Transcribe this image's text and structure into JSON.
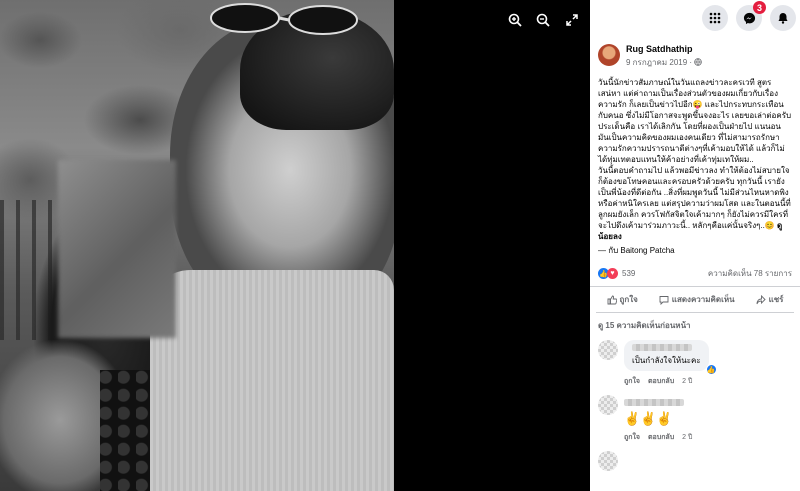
{
  "viewer": {
    "zoom_in_icon": "zoom-in-icon",
    "zoom_out_icon": "zoom-out-icon",
    "fullscreen_icon": "fullscreen-icon"
  },
  "topbar": {
    "menu_icon": "grid-menu-icon",
    "messenger_icon": "messenger-icon",
    "messenger_badge": "3",
    "notification_icon": "bell-icon"
  },
  "post": {
    "author": "Rug Satdhathip",
    "date": "9 กรกฎาคม 2019 · ",
    "globe_icon": "globe-icon",
    "text": "วันนี้นักข่าวสัมภาษณ์ในวันแถลงข่าวละครเวที สูตรเสน่หา แต่ค่าถามเป็นเรื่องส่วนตัวของผมเกี่ยวกับเรื่องความรัก ก็เลยเป็นข่าวไปอีก😜 และไปกระทบกระเทือนกับคนอ ซึ่งไม่มีโอกาสจะพูดขึ้นจงอะไร เลยขอเล่าต่อครับประเด็นคือ เราได้เลิกกัน โดยที่ผองเป็นฝ่ายไป แนนอน มันเป็นความคิดของผมเองคนเดียว ที่ไม่สามารถรักษาความรักความปรารถนาดีต่างๆที่เค้ามอบให้ได้ แล้วก็ไม่ได้ทุ่มเทตอบแทนให้ค้าอย่างที่เค้าทุ่มเทให้ผม..\nวันนี้ตอบคำถามไป แล้วพอมีข่าวลง ทำให้ต้องไม่สบายใจก็ต้องขอโทษคอนและครอบครัวด้วยครับ ทุกวันนี้ เรายังเป็นพี่น้องที่ดีต่อกัน ..สิ่งที่ผมพูดวันนี้ ไม่มีส่วนไหนหาดพิงหรือค่าหนิใครเลย แต่สรุปความว่าผมโสด และในตอนนี้ที่ลูกผมยังเล็ก ควรโฟกัสจิตใจเค้ามากๆ ก็ยังไม่ควรมีใครที่จะไปดึงเค้ามาร่วมภาวะนี้.. หลักๆคือแค่นั้นจริงๆ..😊 ",
    "text_highlight": "ดูน้อยลง",
    "tagline": "— กับ Baitong Patcha"
  },
  "reactions": {
    "like_icon": "like-reaction-icon",
    "love_icon": "love-reaction-icon",
    "count": "539",
    "comments_count": "ความคิดเห็น 78 รายการ"
  },
  "actions": {
    "like_label": "ถูกใจ",
    "comment_label": "แสดงความคิดเห็น",
    "share_label": "แชร์"
  },
  "comments_section": {
    "more_label": "ดู 15 ความคิดเห็นก่อนหน้า",
    "comments": [
      {
        "text": "เป็นกำลังใจให้นะคะ",
        "like_label": "ถูกใจ",
        "reply_label": "ตอบกลับ",
        "time": "2 ปี"
      },
      {
        "text": "✌️✌️✌️",
        "like_label": "ถูกใจ",
        "reply_label": "ตอบกลับ",
        "time": "2 ปี"
      }
    ]
  }
}
